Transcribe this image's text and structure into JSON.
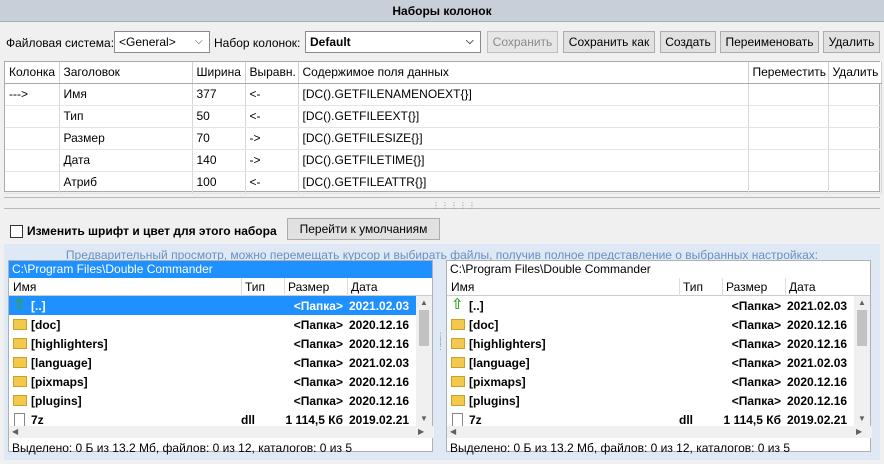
{
  "window_title": "Наборы колонок",
  "toolbar": {
    "fs_label": "Файловая система:",
    "fs_value": "<General>",
    "set_label": "Набор колонок:",
    "set_value": "Default",
    "save": "Сохранить",
    "save_as": "Сохранить как",
    "create": "Создать",
    "rename": "Переименовать",
    "delete": "Удалить"
  },
  "grid": {
    "headers": [
      "Колонка",
      "Заголовок",
      "Ширина",
      "Выравн.",
      "Содержимое поля данных",
      "Переместить",
      "Удалить"
    ],
    "rows": [
      {
        "col": "--->",
        "title": "Имя",
        "width": "377",
        "align": "<-",
        "content": "[DC().GETFILENAMENOEXT{}]"
      },
      {
        "col": "",
        "title": "Тип",
        "width": "50",
        "align": "<-",
        "content": "[DC().GETFILEEXT{}]"
      },
      {
        "col": "",
        "title": "Размер",
        "width": "70",
        "align": "->",
        "content": "[DC().GETFILESIZE{}]"
      },
      {
        "col": "",
        "title": "Дата",
        "width": "140",
        "align": "->",
        "content": "[DC().GETFILETIME{}]"
      },
      {
        "col": "",
        "title": "Атриб",
        "width": "100",
        "align": "<-",
        "content": "[DC().GETFILEATTR{}]"
      }
    ]
  },
  "options": {
    "change_font": "Изменить шрифт и цвет для этого набора",
    "defaults_button": "Перейти к умолчаниям"
  },
  "preview": {
    "hint": "Предварительный просмотр, можно перемещать курсор и выбирать файлы, получив полное представление о выбранных настройках:",
    "columns": {
      "name": "Имя",
      "type": "Тип",
      "size": "Размер",
      "date": "Дата"
    },
    "left": {
      "path": "C:\\Program Files\\Double Commander",
      "status": "Выделено: 0 Б из 13.2 Мб, файлов: 0 из 12, каталогов: 0 из 5"
    },
    "right": {
      "path": "C:\\Program Files\\Double Commander",
      "status": "Выделено: 0 Б из 13.2 Мб, файлов: 0 из 12, каталогов: 0 из 5"
    },
    "files": [
      {
        "icon": "up-arrow-icon",
        "name": "[..]",
        "type": "",
        "size": "<Папка>",
        "date": "2021.02.03"
      },
      {
        "icon": "folder-icon",
        "name": "[doc]",
        "type": "",
        "size": "<Папка>",
        "date": "2020.12.16"
      },
      {
        "icon": "folder-icon",
        "name": "[highlighters]",
        "type": "",
        "size": "<Папка>",
        "date": "2020.12.16"
      },
      {
        "icon": "folder-icon",
        "name": "[language]",
        "type": "",
        "size": "<Папка>",
        "date": "2021.02.03"
      },
      {
        "icon": "folder-icon",
        "name": "[pixmaps]",
        "type": "",
        "size": "<Папка>",
        "date": "2020.12.16"
      },
      {
        "icon": "folder-icon",
        "name": "[plugins]",
        "type": "",
        "size": "<Папка>",
        "date": "2020.12.16"
      },
      {
        "icon": "file-icon",
        "name": "7z",
        "type": "dll",
        "size": "1 114,5 Кб",
        "date": "2019.02.21"
      }
    ]
  },
  "colors": {
    "selection": "#1e90ff",
    "header_bg": "#c9cfd8",
    "preview_bg": "#dfe9f5",
    "hint_text": "#6a8fc0"
  }
}
